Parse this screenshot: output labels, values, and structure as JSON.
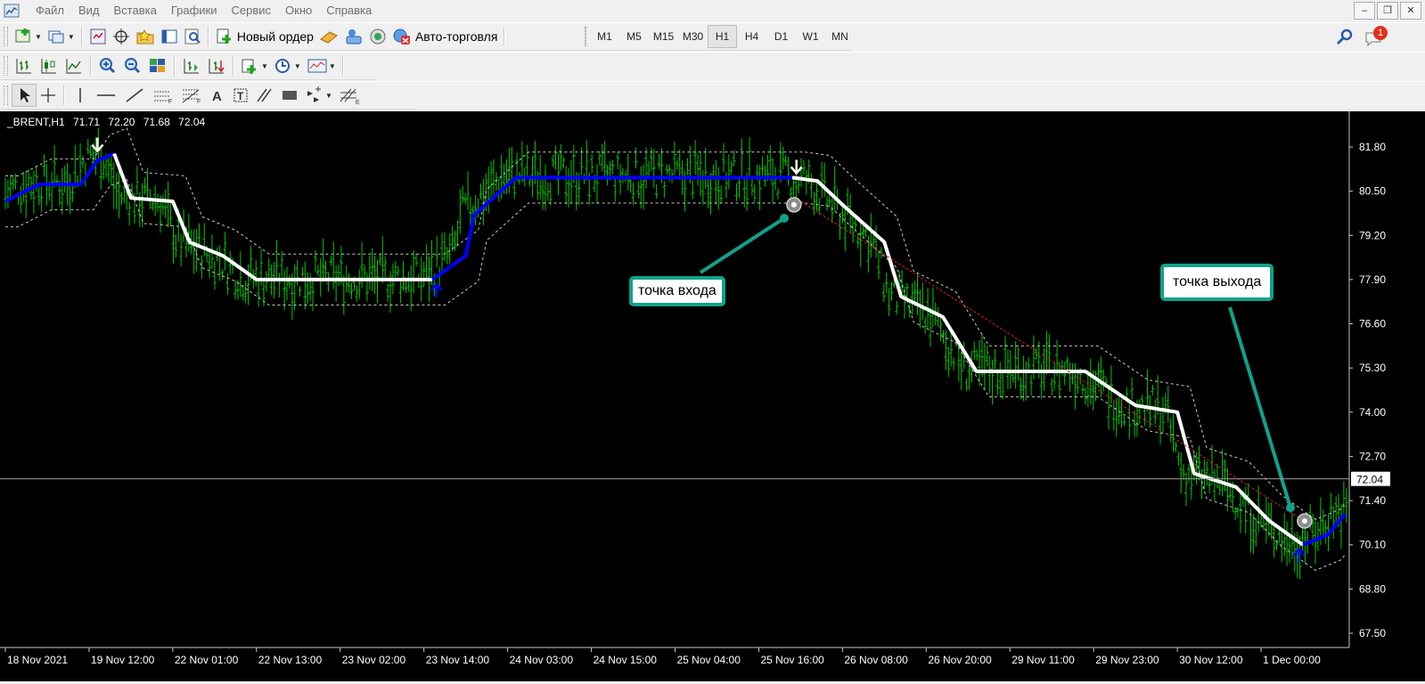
{
  "menu": {
    "items": [
      "Файл",
      "Вид",
      "Вставка",
      "Графики",
      "Сервис",
      "Окно",
      "Справка"
    ]
  },
  "toolbar": {
    "new_order_label": "Новый ордер",
    "autotrading_label": "Авто-торговля",
    "timeframes": [
      "M1",
      "M5",
      "M15",
      "M30",
      "H1",
      "H4",
      "D1",
      "W1",
      "MN"
    ],
    "active_timeframe": "H1",
    "notification_count": "1"
  },
  "chart": {
    "symbol": "_BRENT,H1",
    "ohlc": [
      "71.71",
      "72.20",
      "71.68",
      "72.04"
    ],
    "current_price": "72.04",
    "price_axis": [
      "81.80",
      "80.50",
      "79.20",
      "77.90",
      "76.60",
      "75.30",
      "74.00",
      "72.70",
      "71.40",
      "70.10",
      "68.80",
      "67.50"
    ],
    "time_axis": [
      "18 Nov 2021",
      "19 Nov 12:00",
      "22 Nov 01:00",
      "22 Nov 13:00",
      "23 Nov 02:00",
      "23 Nov 14:00",
      "24 Nov 03:00",
      "24 Nov 15:00",
      "25 Nov 04:00",
      "25 Nov 16:00",
      "26 Nov 08:00",
      "26 Nov 20:00",
      "29 Nov 11:00",
      "29 Nov 23:00",
      "30 Nov 12:00",
      "1 Dec 00:00"
    ],
    "colors": {
      "background": "#000000",
      "candles": "#00c800",
      "trend_up": "#0000ff",
      "trend_down": "#ffffff",
      "channel": "#c8c8c8",
      "trade_line": "#d02020",
      "callout_border": "#0fa28a"
    },
    "callouts": {
      "entry": "точка входа",
      "exit": "точка выхода"
    },
    "signals": {
      "sell": [
        "19 Nov 12:00",
        "25 Nov 16:00"
      ],
      "buy": [
        "23 Nov 14:00",
        "1 Dec 00:00"
      ]
    }
  },
  "chart_data": {
    "type": "line",
    "title": "_BRENT,H1",
    "ylim": [
      67.0,
      82.3
    ],
    "grid": false,
    "x_ticks": [
      "18 Nov 2021",
      "19 Nov 12:00",
      "22 Nov 01:00",
      "22 Nov 13:00",
      "23 Nov 02:00",
      "23 Nov 14:00",
      "24 Nov 03:00",
      "24 Nov 15:00",
      "25 Nov 04:00",
      "25 Nov 16:00",
      "26 Nov 08:00",
      "26 Nov 20:00",
      "29 Nov 11:00",
      "29 Nov 23:00",
      "30 Nov 12:00",
      "1 Dec 00:00"
    ],
    "y_ticks": [
      81.8,
      80.5,
      79.2,
      77.9,
      76.6,
      75.3,
      74.0,
      72.7,
      71.4,
      70.1,
      68.8,
      67.5
    ],
    "series": [
      {
        "role": "trend",
        "points": [
          [
            0,
            80.2
          ],
          [
            0.4,
            80.7
          ],
          [
            0.9,
            80.7
          ],
          [
            1.1,
            81.4
          ],
          [
            1.3,
            81.6
          ],
          [
            1.5,
            80.3
          ],
          [
            2.0,
            80.2
          ],
          [
            2.2,
            79.0
          ],
          [
            2.6,
            78.6
          ],
          [
            3.0,
            77.9
          ],
          [
            5.1,
            77.9
          ],
          [
            5.5,
            78.6
          ],
          [
            5.6,
            79.8
          ],
          [
            6.1,
            80.9
          ],
          [
            9.4,
            80.9
          ],
          [
            9.7,
            80.8
          ],
          [
            10.0,
            80.1
          ],
          [
            10.5,
            79.0
          ],
          [
            10.7,
            77.4
          ],
          [
            11.2,
            76.8
          ],
          [
            11.6,
            75.2
          ],
          [
            12.9,
            75.2
          ],
          [
            13.5,
            74.2
          ],
          [
            14.0,
            74.0
          ],
          [
            14.2,
            72.2
          ],
          [
            14.7,
            71.8
          ],
          [
            15.1,
            70.8
          ],
          [
            15.5,
            70.1
          ],
          [
            15.8,
            70.4
          ],
          [
            16.0,
            71.0
          ]
        ]
      }
    ]
  }
}
